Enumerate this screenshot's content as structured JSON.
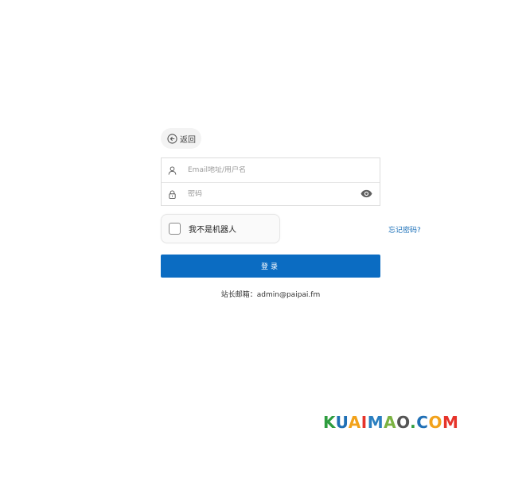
{
  "back": {
    "label": "返回"
  },
  "form": {
    "username_placeholder": "Email地址/用户名",
    "username_value": "",
    "password_placeholder": "密码",
    "password_value": ""
  },
  "captcha": {
    "label": "我不是机器人",
    "checked": false
  },
  "forgot": {
    "label": "忘记密码?"
  },
  "login": {
    "label": "登录"
  },
  "footer": {
    "admin_email": "站长邮箱：admin@paipai.fm"
  },
  "watermark": {
    "text": "KUAIMAO.COM",
    "colors": [
      "#2e9d3f",
      "#1f6fb5",
      "#f2a21b",
      "#e6332a",
      "#2a7fc0",
      "#7bb342",
      "#555555"
    ]
  }
}
